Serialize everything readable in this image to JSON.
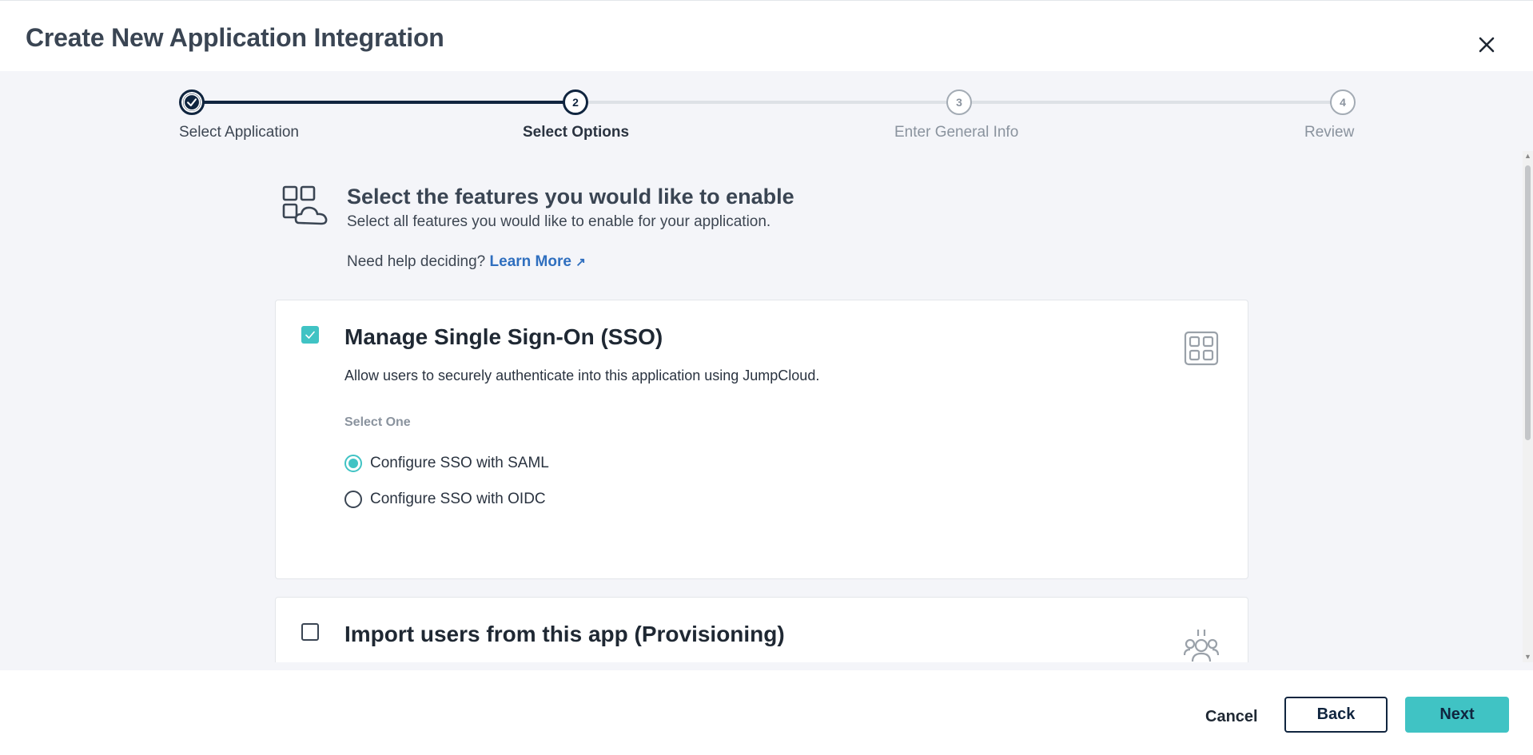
{
  "header": {
    "title": "Create New Application Integration"
  },
  "stepper": {
    "steps": [
      {
        "number": "1",
        "label": "Select Application",
        "state": "complete"
      },
      {
        "number": "2",
        "label": "Select Options",
        "state": "active"
      },
      {
        "number": "3",
        "label": "Enter General Info",
        "state": "upcoming"
      },
      {
        "number": "4",
        "label": "Review",
        "state": "upcoming"
      }
    ]
  },
  "features": {
    "title": "Select the features you would like to enable",
    "subtitle": "Select all features you would like to enable for your application.",
    "help_prefix": "Need help deciding?",
    "help_link": "Learn More",
    "help_link_icon": "↗"
  },
  "sso_card": {
    "checked": true,
    "title": "Manage Single Sign-On (SSO)",
    "description": "Allow users to securely authenticate into this application using JumpCloud.",
    "select_label": "Select One",
    "options": [
      {
        "label": "Configure SSO with SAML",
        "selected": true
      },
      {
        "label": "Configure SSO with OIDC",
        "selected": false
      }
    ]
  },
  "provisioning_card": {
    "checked": false,
    "title": "Import users from this app (Provisioning)"
  },
  "footer": {
    "cancel_label": "Cancel",
    "back_label": "Back",
    "next_label": "Next"
  },
  "colors": {
    "accent": "#40c3c4",
    "navy": "#10253f",
    "link": "#2f6fbf"
  }
}
